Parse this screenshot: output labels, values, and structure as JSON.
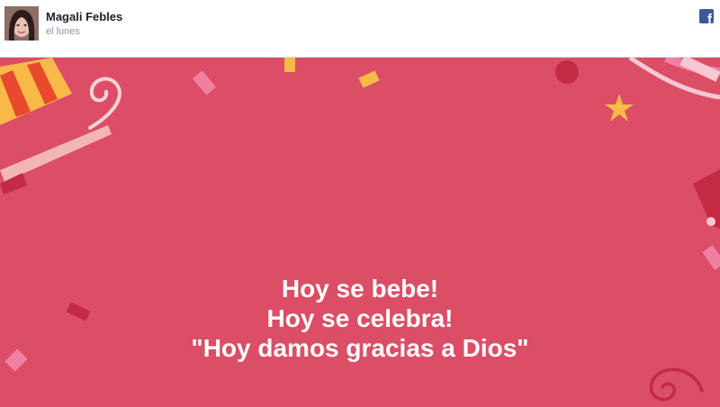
{
  "post": {
    "author": "Magali Febles",
    "time": "el lunes",
    "source_icon": "facebook-icon"
  },
  "card": {
    "background_color": "#db4e66",
    "lines": [
      "Hoy se bebe!",
      "Hoy se celebra!",
      "\"Hoy damos gracias a Dios\""
    ]
  }
}
